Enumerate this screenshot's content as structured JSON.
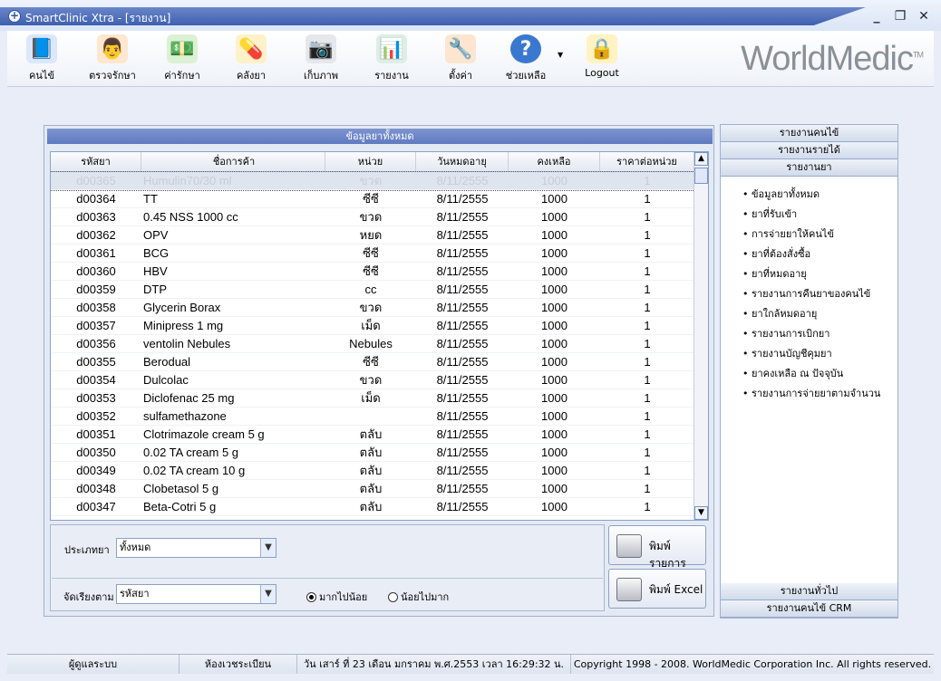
{
  "window": {
    "title": "SmartClinic Xtra - [รายงาน]",
    "controls": [
      "_",
      "❐",
      "✕"
    ]
  },
  "toolbar": {
    "items": [
      {
        "label": "คนไข้",
        "icon": "patient-book-icon",
        "color": "#4a7fd0"
      },
      {
        "label": "ตรวจรักษา",
        "icon": "doctor-icon",
        "color": "#e08a3a"
      },
      {
        "label": "ค่ารักษา",
        "icon": "money-icon",
        "color": "#3f9a3a"
      },
      {
        "label": "คลังยา",
        "icon": "capsule-icon",
        "color": "#e8a21f"
      },
      {
        "label": "เก็บภาพ",
        "icon": "camera-icon",
        "color": "#555a66"
      },
      {
        "label": "รายงาน",
        "icon": "bar-chart-icon",
        "color": "#2f8f5a"
      },
      {
        "label": "ตั้งค่า",
        "icon": "tools-icon",
        "color": "#d97a2a"
      },
      {
        "label": "ช่วยเหลือ",
        "icon": "help-icon",
        "color": "#3a78d0"
      },
      {
        "label": "Logout",
        "icon": "lock-icon",
        "color": "#e2b22a"
      }
    ],
    "brand": "WorldMedic",
    "brand_tm": "TM"
  },
  "main": {
    "section_title": "ข้อมูลยาทั้งหมด",
    "columns": [
      "รหัสยา",
      "ชื่อการค้า",
      "หน่วย",
      "วันหมดอายุ",
      "คงเหลือ",
      "ราคาต่อหน่วย"
    ],
    "rows": [
      [
        "d00365",
        "Humulin70/30 ml",
        "ขวด",
        "8/11/2555",
        "1000",
        "1"
      ],
      [
        "d00364",
        "TT",
        "ซีซี",
        "8/11/2555",
        "1000",
        "1"
      ],
      [
        "d00363",
        "0.45 NSS  1000 cc",
        "ขวด",
        "8/11/2555",
        "1000",
        "1"
      ],
      [
        "d00362",
        "OPV",
        "หยด",
        "8/11/2555",
        "1000",
        "1"
      ],
      [
        "d00361",
        "BCG",
        "ซีซี",
        "8/11/2555",
        "1000",
        "1"
      ],
      [
        "d00360",
        "HBV",
        "ซีซี",
        "8/11/2555",
        "1000",
        "1"
      ],
      [
        "d00359",
        "DTP",
        "cc",
        "8/11/2555",
        "1000",
        "1"
      ],
      [
        "d00358",
        "Glycerin Borax",
        "ขวด",
        "8/11/2555",
        "1000",
        "1"
      ],
      [
        "d00357",
        "Minipress 1 mg",
        "เม็ด",
        "8/11/2555",
        "1000",
        "1"
      ],
      [
        "d00356",
        "ventolin Nebules",
        "Nebules",
        "8/11/2555",
        "1000",
        "1"
      ],
      [
        "d00355",
        "Berodual",
        "ซีซี",
        "8/11/2555",
        "1000",
        "1"
      ],
      [
        "d00354",
        "Dulcolac",
        "ขวด",
        "8/11/2555",
        "1000",
        "1"
      ],
      [
        "d00353",
        "Diclofenac 25 mg",
        "เม็ด",
        "8/11/2555",
        "1000",
        "1"
      ],
      [
        "d00352",
        "sulfamethazone",
        "",
        "8/11/2555",
        "1000",
        "1"
      ],
      [
        "d00351",
        "Clotrimazole cream 5 g",
        "ตลับ",
        "8/11/2555",
        "1000",
        "1"
      ],
      [
        "d00350",
        "0.02 TA cream 5 g",
        "ตลับ",
        "8/11/2555",
        "1000",
        "1"
      ],
      [
        "d00349",
        "0.02 TA cream 10 g",
        "ตลับ",
        "8/11/2555",
        "1000",
        "1"
      ],
      [
        "d00348",
        "Clobetasol 5 g",
        "ตลับ",
        "8/11/2555",
        "1000",
        "1"
      ],
      [
        "d00347",
        "Beta-Cotri 5 g",
        "ตลับ",
        "8/11/2555",
        "1000",
        "1"
      ]
    ],
    "selected_row": 0,
    "filter": {
      "type_label": "ประเภทยา",
      "type_value": "ทั้งหมด",
      "sort_label": "จัดเรียงตาม",
      "sort_value": "รหัสยา",
      "radio_desc": "มากไปน้อย",
      "radio_asc": "น้อยไปมาก",
      "radio_selected": "desc"
    },
    "buttons": {
      "print_list": "พิมพ์รายการ",
      "print_excel": "พิมพ์ Excel"
    }
  },
  "side": {
    "headers": [
      "รายงานคนไข้",
      "รายงานรายได้",
      "รายงานยา"
    ],
    "items": [
      "ข้อมูลยาทั้งหมด",
      "ยาที่รับเข้า",
      "การจ่ายยาให้คนไข้",
      "ยาที่ต้องสั่งซื้อ",
      "ยาที่หมดอายุ",
      "รายงานการคืนยาของคนไข้",
      "ยาใกล้หมดอายุ",
      "รายงานการเบิกยา",
      "รายงานบัญชีคุมยา",
      "ยาคงเหลือ ณ ปัจจุบัน",
      "รายงานการจ่ายยาตามจำนวน"
    ],
    "footers": [
      "รายงานทั่วไป",
      "รายงานคนไข้ CRM"
    ]
  },
  "status": {
    "user": "ผู้ดูแลระบบ",
    "room": "ห้องเวชระเบียน",
    "datetime": "วัน เสาร์ ที่ 23 เดือน มกราคม พ.ศ.2553 เวลา 16:29:32 น.",
    "copyright": "Copyright 1998 - 2008. WorldMedic Corporation Inc. All rights reserved."
  }
}
